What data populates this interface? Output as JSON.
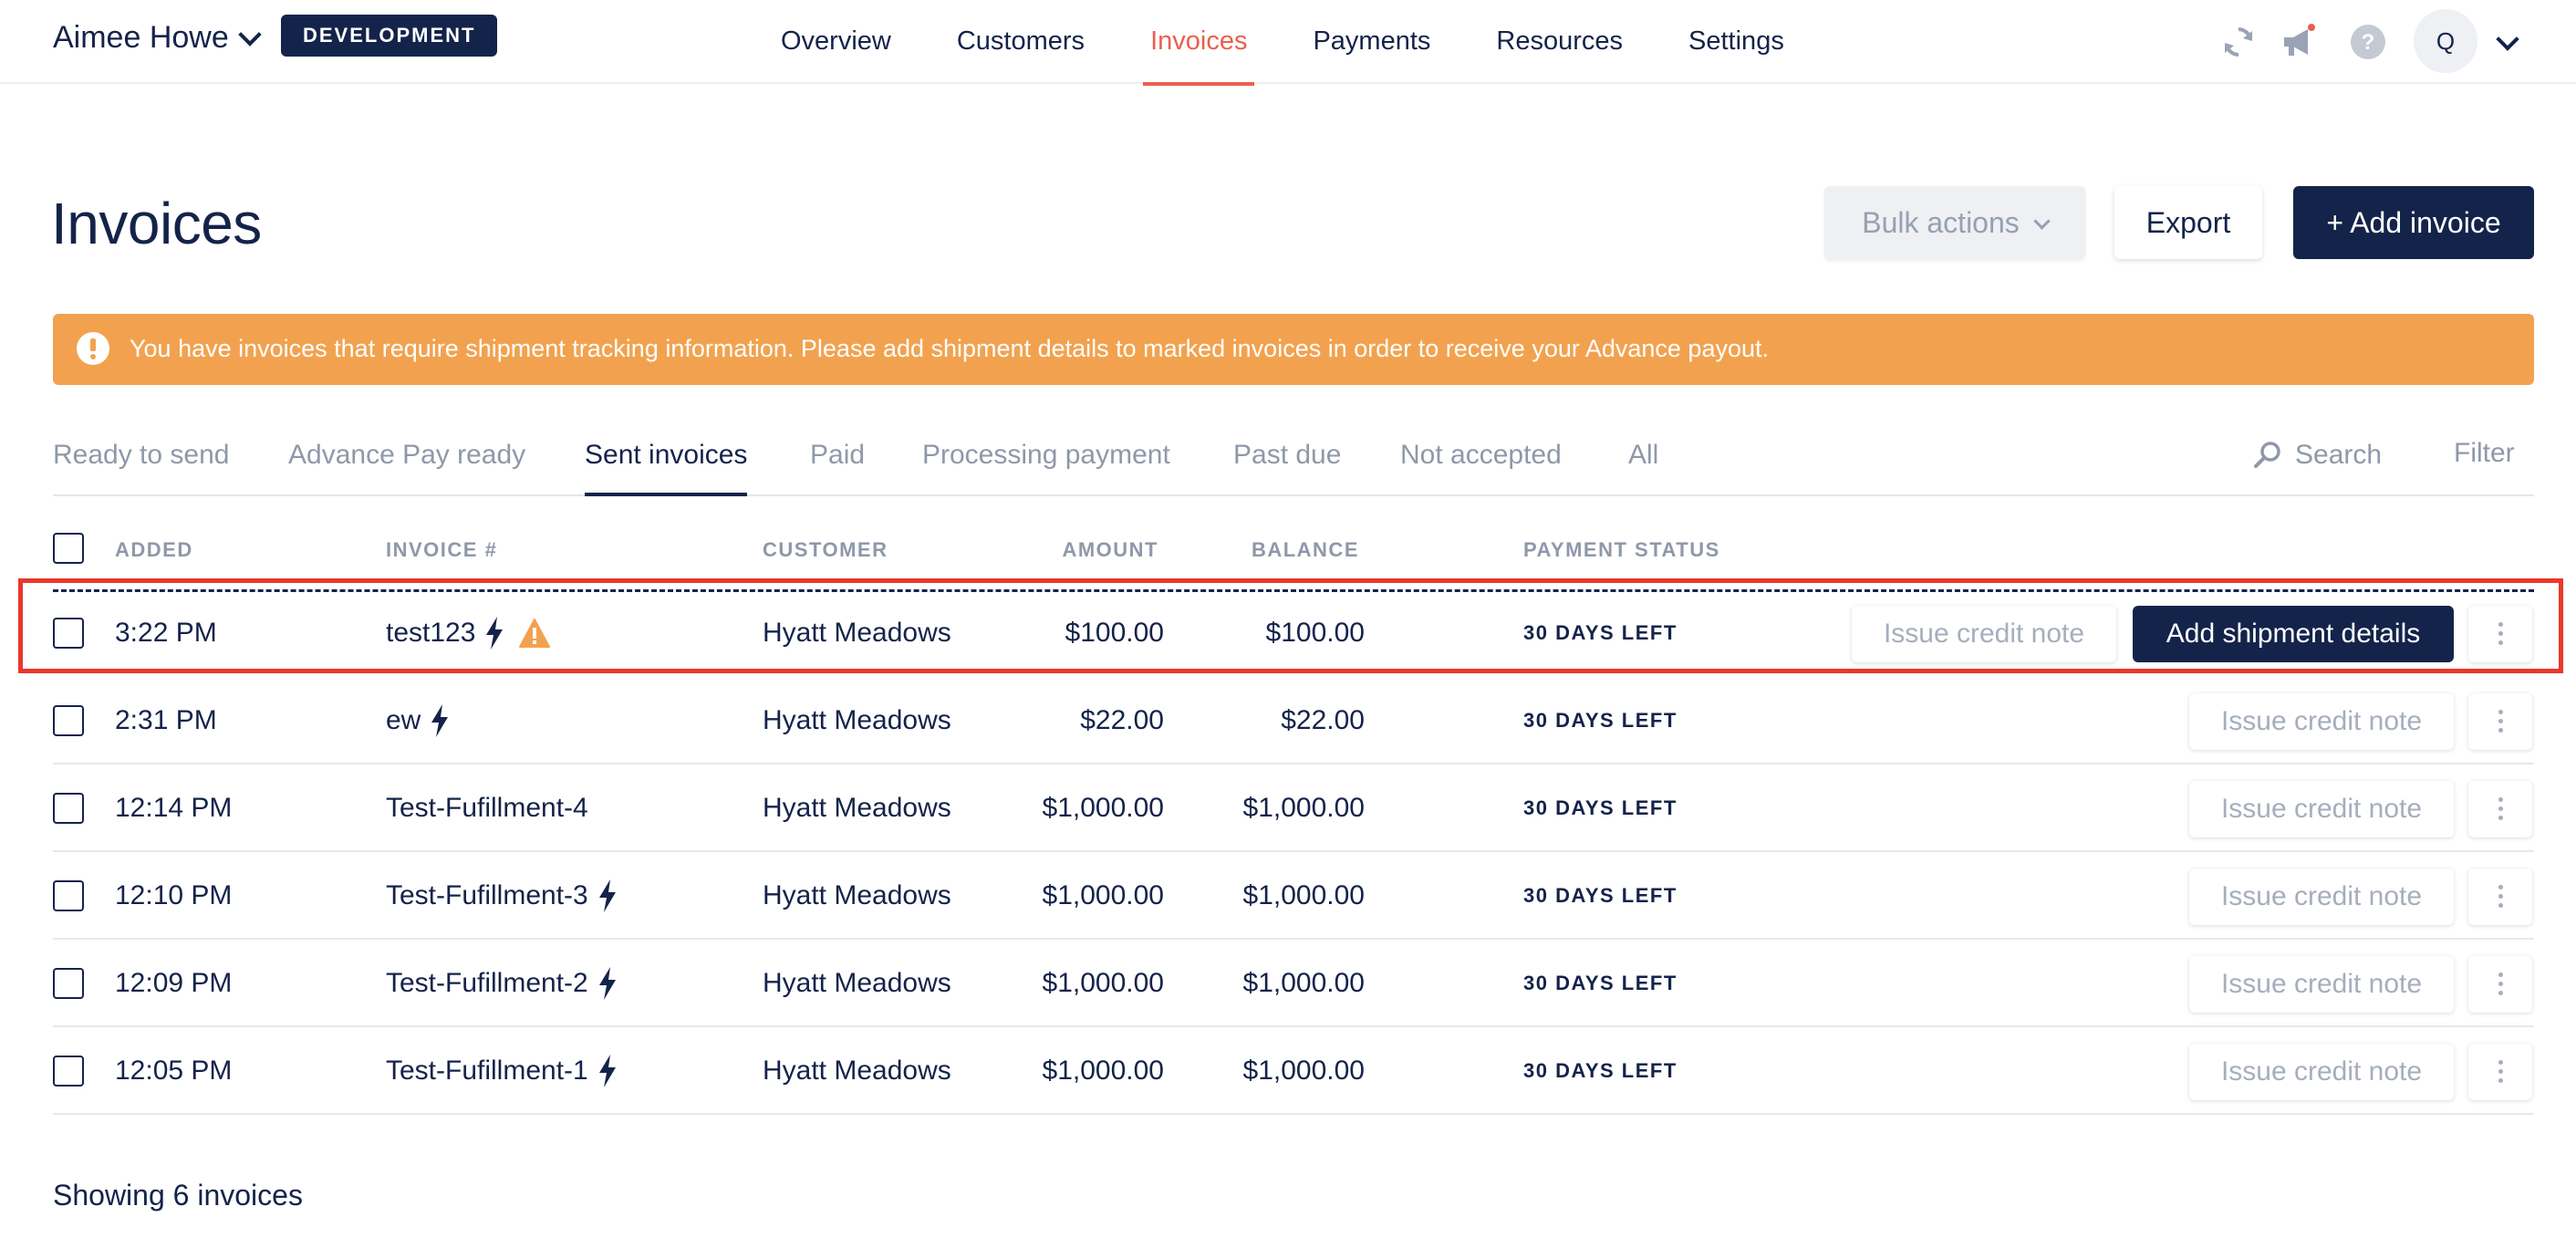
{
  "account": {
    "name": "Aimee Howe",
    "env_badge": "DEVELOPMENT"
  },
  "nav": {
    "tabs": [
      {
        "label": "Overview"
      },
      {
        "label": "Customers"
      },
      {
        "label": "Invoices",
        "active": true
      },
      {
        "label": "Payments"
      },
      {
        "label": "Resources"
      },
      {
        "label": "Settings"
      }
    ],
    "avatar_initial": "Q",
    "icons": [
      "sync-icon",
      "megaphone-icon",
      "help-icon"
    ]
  },
  "page": {
    "title": "Invoices",
    "bulk_actions": "Bulk actions",
    "export": "Export",
    "add_invoice": "+ Add invoice"
  },
  "alert": {
    "text": "You have invoices that require shipment tracking information. Please add shipment details to marked invoices in order to receive your Advance payout.",
    "color": "#f2a24f"
  },
  "subtabs": [
    {
      "label": "Ready to send"
    },
    {
      "label": "Advance Pay ready"
    },
    {
      "label": "Sent invoices",
      "active": true
    },
    {
      "label": "Paid"
    },
    {
      "label": "Processing payment"
    },
    {
      "label": "Past due"
    },
    {
      "label": "Not accepted"
    },
    {
      "label": "All"
    }
  ],
  "search_label": "Search",
  "filter_label": "Filter",
  "table": {
    "headers": {
      "added": "ADDED",
      "invoice": "INVOICE #",
      "customer": "CUSTOMER",
      "amount": "AMOUNT",
      "balance": "BALANCE",
      "status": "PAYMENT STATUS"
    },
    "rows": [
      {
        "added": "3:22 PM",
        "invoice": "test123",
        "customer": "Hyatt Meadows",
        "amount": "$100.00",
        "balance": "$100.00",
        "status": "30 DAYS LEFT",
        "advance": true,
        "warning": true,
        "credit_label": "Issue credit note",
        "ship_label": "Add shipment details"
      },
      {
        "added": "2:31 PM",
        "invoice": "ew",
        "customer": "Hyatt Meadows",
        "amount": "$22.00",
        "balance": "$22.00",
        "status": "30 DAYS LEFT",
        "advance": true,
        "credit_label": "Issue credit note"
      },
      {
        "added": "12:14 PM",
        "invoice": "Test-Fufillment-4",
        "customer": "Hyatt Meadows",
        "amount": "$1,000.00",
        "balance": "$1,000.00",
        "status": "30 DAYS LEFT",
        "advance": false,
        "credit_label": "Issue credit note"
      },
      {
        "added": "12:10 PM",
        "invoice": "Test-Fufillment-3",
        "customer": "Hyatt Meadows",
        "amount": "$1,000.00",
        "balance": "$1,000.00",
        "status": "30 DAYS LEFT",
        "advance": true,
        "credit_label": "Issue credit note"
      },
      {
        "added": "12:09 PM",
        "invoice": "Test-Fufillment-2",
        "customer": "Hyatt Meadows",
        "amount": "$1,000.00",
        "balance": "$1,000.00",
        "status": "30 DAYS LEFT",
        "advance": true,
        "credit_label": "Issue credit note"
      },
      {
        "added": "12:05 PM",
        "invoice": "Test-Fufillment-1",
        "customer": "Hyatt Meadows",
        "amount": "$1,000.00",
        "balance": "$1,000.00",
        "status": "30 DAYS LEFT",
        "advance": true,
        "credit_label": "Issue credit note"
      }
    ]
  },
  "footer": {
    "text": "Showing 6 invoices"
  },
  "colors": {
    "navy": "#14234a",
    "accent_red": "#ea5f4e",
    "highlight": "#e9382b",
    "muted": "#8f98aa"
  }
}
